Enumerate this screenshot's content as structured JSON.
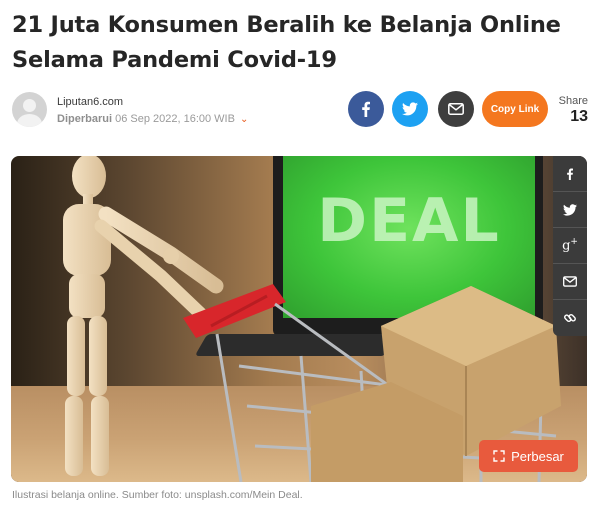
{
  "article": {
    "title": "21 Juta Konsumen Beralih ke Belanja Online Selama Pandemi Covid-19"
  },
  "meta": {
    "source": "Liputan6.com",
    "updated_label": "Diperbarui",
    "updated_time": "06 Sep 2022, 16:00 WIB"
  },
  "share": {
    "copy_link_label": "Copy Link",
    "count_label": "Share",
    "count": "13",
    "colors": {
      "facebook": "#3b5a9a",
      "twitter": "#1da1f2",
      "email": "#3e3e3e",
      "copy_link": "#f4771f"
    }
  },
  "image": {
    "screen_text": "DEAL",
    "zoom_label": "Perbesar",
    "side_share_icons": [
      "facebook-icon",
      "twitter-icon",
      "google-plus-icon",
      "email-icon",
      "link-icon"
    ]
  },
  "caption": "Ilustrasi belanja online. Sumber foto: unsplash.com/Mein Deal."
}
